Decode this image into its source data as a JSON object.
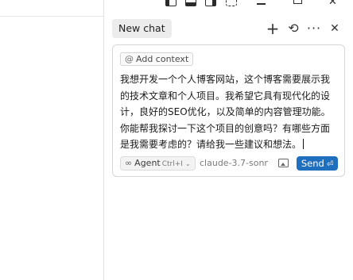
{
  "window_controls": {
    "close_glyph": "✕"
  },
  "tabbar": {
    "active_tab_label": "New chat",
    "icons": [
      "plus-icon",
      "history-icon",
      "more-icon",
      "close-icon"
    ],
    "plus_glyph": "+",
    "history_glyph": "⟲",
    "more_glyph": "···",
    "close_glyph": "✕"
  },
  "composer": {
    "add_context_label": "Add context",
    "add_context_prefix": "@",
    "message": "我想开发一个个人博客网站，这个博客需要展示我的技术文章和个人项目。我希望它具有现代化的设计，良好的SEO优化，以及简单的内容管理功能。你能帮我探讨一下这个项目的创意吗？有哪些方面是我需要考虑的？请给我一些建议和想法。",
    "mode": {
      "icon_glyph": "∞",
      "label": "Agent",
      "shortcut": "Ctrl+I",
      "chevron": "⌄"
    },
    "model_name": "claude-3.7-sonn",
    "send_label": "Send",
    "send_key_glyph": "⏎"
  },
  "colors": {
    "send_button": "#1f6fbf",
    "tab_bg": "#ececec",
    "border": "#d6d6d6"
  }
}
